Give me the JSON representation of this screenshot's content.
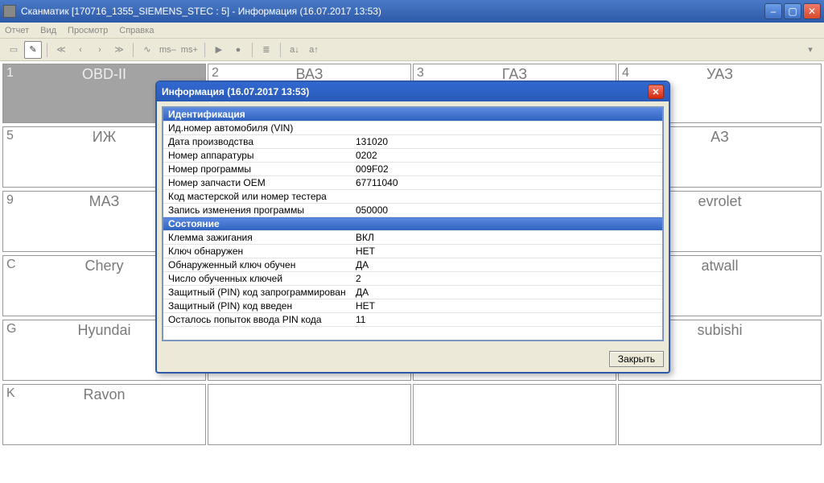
{
  "window": {
    "title": "Сканматик [170716_1355_SIEMENS_STEC : 5] - Информация (16.07.2017  13:53)"
  },
  "menu": {
    "report": "Отчет",
    "view": "Вид",
    "browse": "Просмотр",
    "help": "Справка"
  },
  "toolbar": {
    "ms_label": "ms",
    "a_plus": "a↑",
    "a_minus": "a↓"
  },
  "grid": {
    "rows": [
      [
        {
          "idx": "1",
          "label": "OBD-II",
          "hdr": true
        },
        {
          "idx": "2",
          "label": "ВАЗ"
        },
        {
          "idx": "3",
          "label": "ГАЗ"
        },
        {
          "idx": "4",
          "label": "УАЗ"
        }
      ],
      [
        {
          "idx": "5",
          "label": "ИЖ"
        },
        {
          "idx": "",
          "label": ""
        },
        {
          "idx": "",
          "label": ""
        },
        {
          "idx": "",
          "label": "АЗ"
        }
      ],
      [
        {
          "idx": "9",
          "label": "МАЗ"
        },
        {
          "idx": "",
          "label": ""
        },
        {
          "idx": "",
          "label": ""
        },
        {
          "idx": "",
          "label": "evrolet"
        }
      ],
      [
        {
          "idx": "C",
          "label": "Chery"
        },
        {
          "idx": "",
          "label": ""
        },
        {
          "idx": "",
          "label": ""
        },
        {
          "idx": "",
          "label": "atwall"
        }
      ],
      [
        {
          "idx": "G",
          "label": "Hyundai"
        },
        {
          "idx": "",
          "label": ""
        },
        {
          "idx": "",
          "label": ""
        },
        {
          "idx": "",
          "label": "subishi"
        }
      ],
      [
        {
          "idx": "K",
          "label": "Ravon"
        },
        {
          "idx": "",
          "label": ""
        },
        {
          "idx": "",
          "label": ""
        },
        {
          "idx": "",
          "label": ""
        }
      ]
    ]
  },
  "dialog": {
    "title": "Информация (16.07.2017  13:53)",
    "close_btn": "Закрыть",
    "sections": {
      "ident": "Идентификация",
      "state": "Состояние"
    },
    "rows": [
      {
        "k": "Ид.номер автомобиля (VIN)",
        "v": ""
      },
      {
        "k": "Дата производства",
        "v": "131020"
      },
      {
        "k": "Номер аппаратуры",
        "v": "0202"
      },
      {
        "k": "Номер программы",
        "v": "009F02"
      },
      {
        "k": "Номер запчасти OEM",
        "v": "  67711040"
      },
      {
        "k": "Код мастерской или номер тестера",
        "v": ""
      },
      {
        "k": "Запись изменения программы",
        "v": "050000"
      }
    ],
    "rows2": [
      {
        "k": "Клемма зажигания",
        "v": "ВКЛ"
      },
      {
        "k": "Ключ обнаружен",
        "v": "НЕТ"
      },
      {
        "k": "Обнаруженный ключ обучен",
        "v": "ДА"
      },
      {
        "k": "Число обученных ключей",
        "v": "2"
      },
      {
        "k": "Защитный (PIN) код запрограммирован",
        "v": "ДА"
      },
      {
        "k": "Защитный (PIN) код введен",
        "v": "НЕТ"
      },
      {
        "k": "Осталось попыток ввода PIN кода",
        "v": "11"
      }
    ]
  }
}
